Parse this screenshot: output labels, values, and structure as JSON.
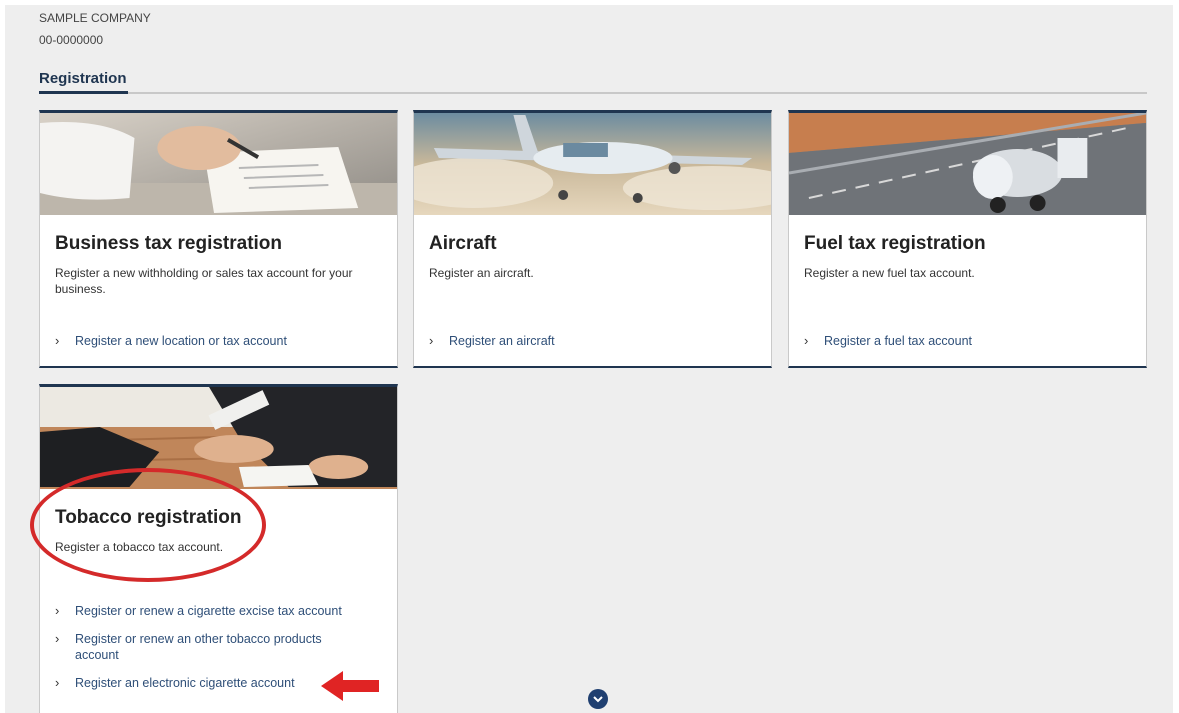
{
  "company": {
    "name": "SAMPLE COMPANY",
    "id": "00-0000000"
  },
  "section": {
    "title": "Registration"
  },
  "cards": [
    {
      "title": "Business tax registration",
      "description": "Register a new withholding or sales tax account for your business.",
      "links": [
        "Register a new location or tax account"
      ]
    },
    {
      "title": "Aircraft",
      "description": "Register an aircraft.",
      "links": [
        "Register an aircraft"
      ]
    },
    {
      "title": "Fuel tax registration",
      "description": "Register a new fuel tax account.",
      "links": [
        "Register a fuel tax account"
      ]
    },
    {
      "title": "Tobacco registration",
      "description": "Register a tobacco tax account.",
      "links": [
        "Register or renew a cigarette excise tax account",
        "Register or renew an other tobacco products account",
        "Register an electronic cigarette account"
      ]
    }
  ],
  "icons": {
    "link_chevron": "chevron-right-icon",
    "scroll": "chevron-down-icon"
  },
  "colors": {
    "accent": "#1f3550",
    "link": "#2f4f78",
    "annotation": "#d42a2a",
    "background": "#eeeeee"
  }
}
